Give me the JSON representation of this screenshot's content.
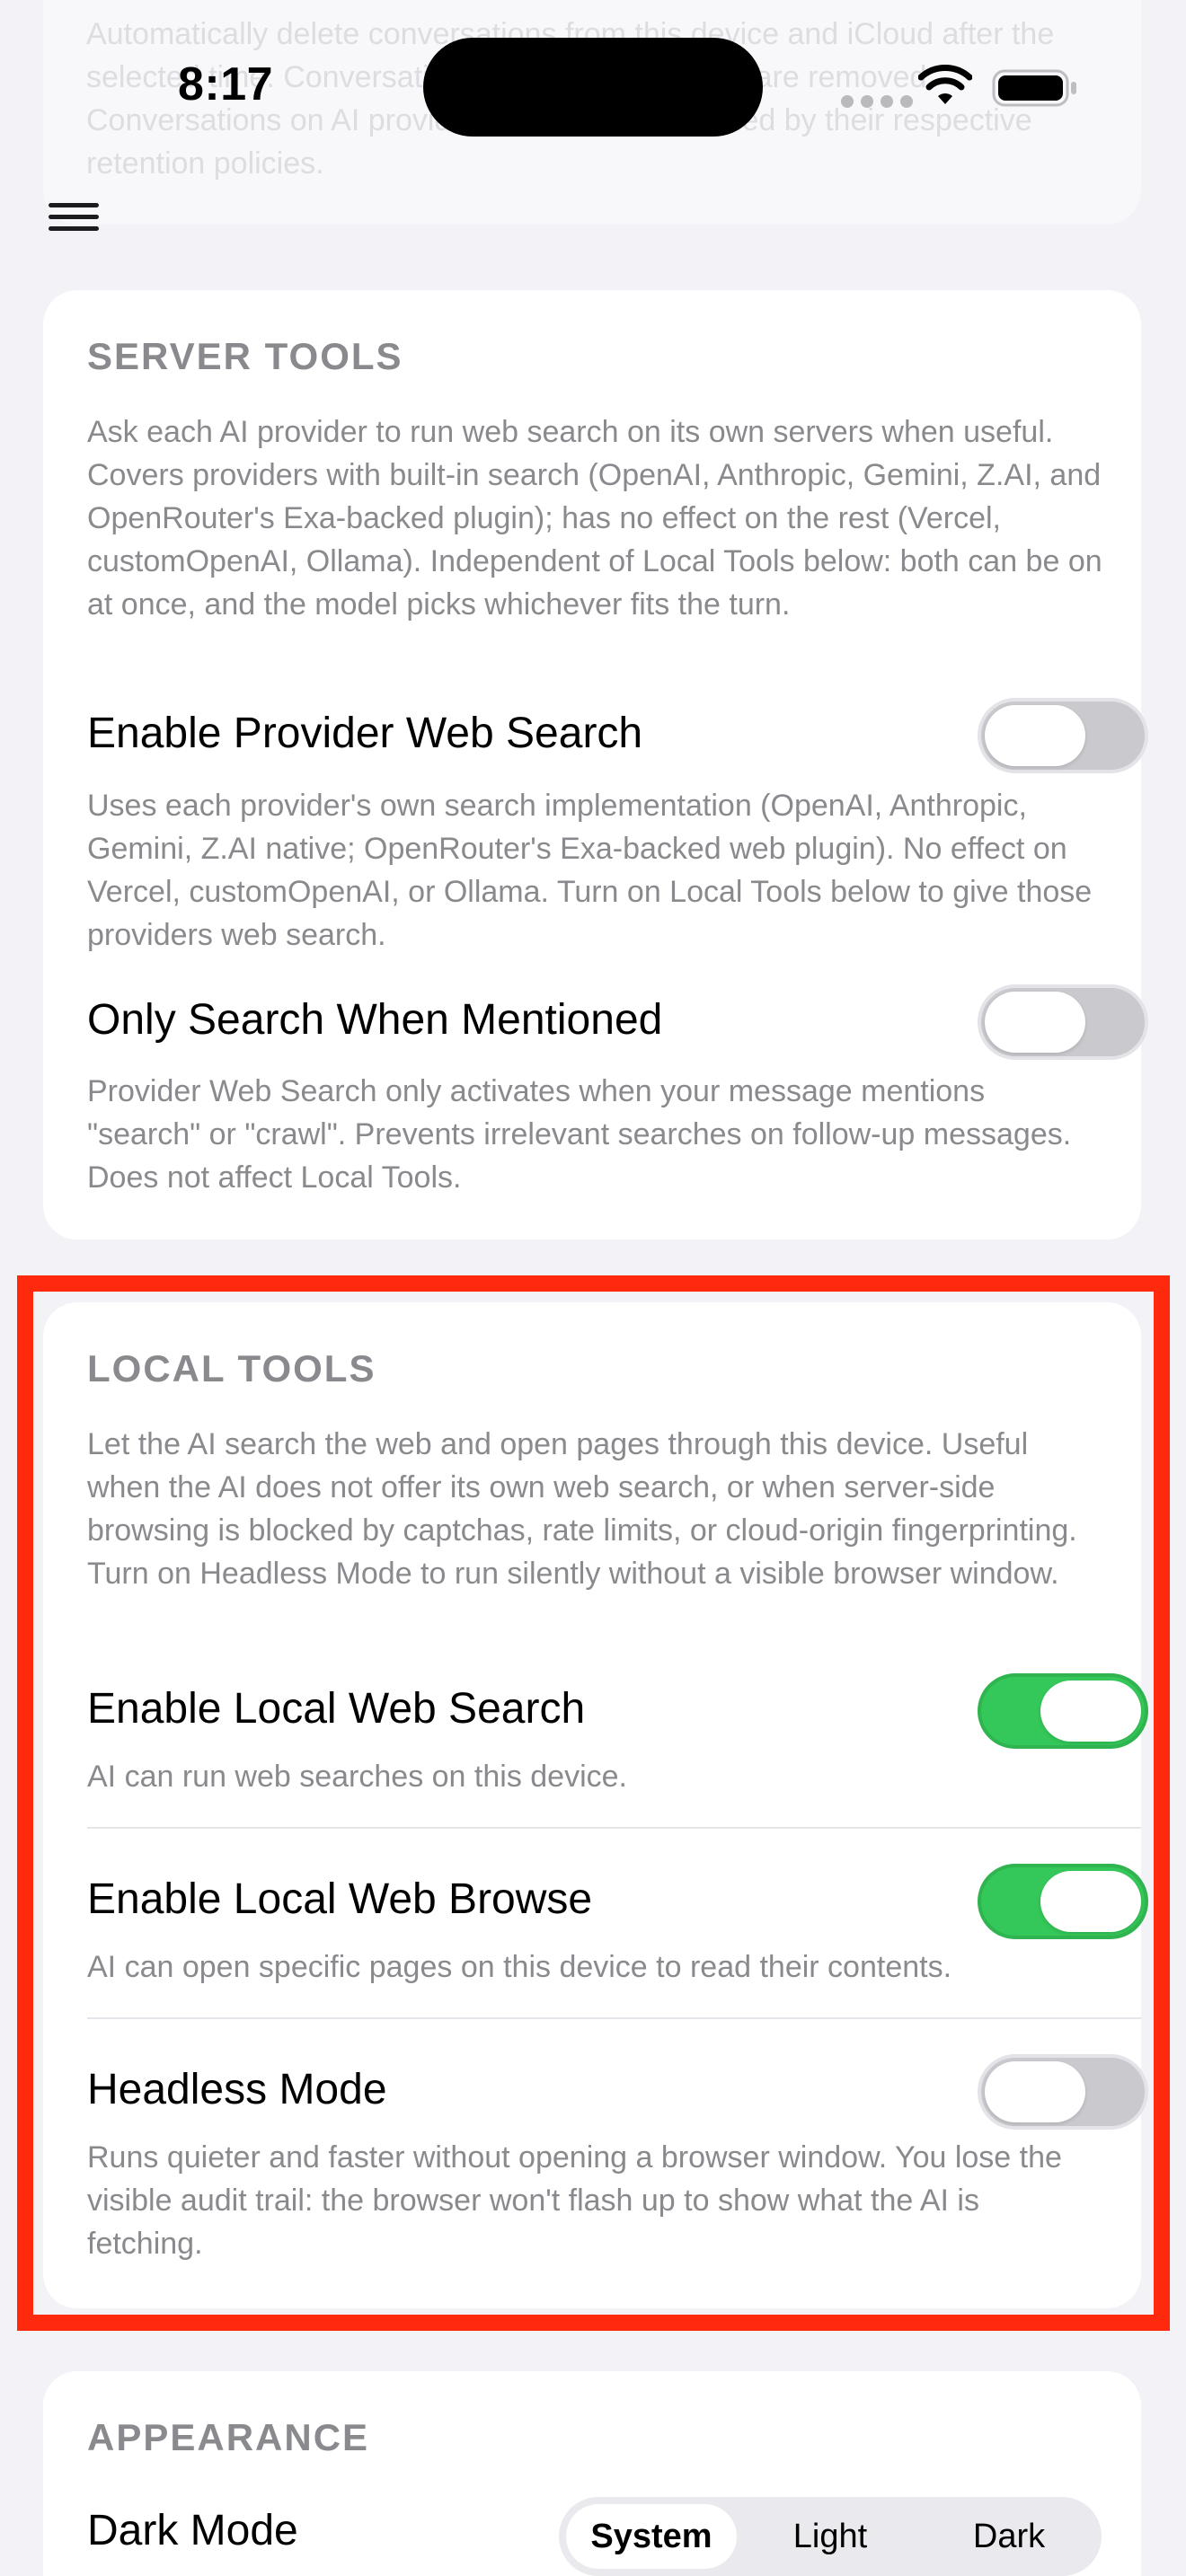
{
  "status_bar": {
    "time": "8:17",
    "wifi_icon": "wifi-icon",
    "battery_icon": "battery-icon"
  },
  "background_text": "Automatically delete conversations from this device and iCloud after the selected time. Conversations and captured items are removed. Conversations on AI provider servers are governed by their respective retention policies.",
  "menu_icon": "hamburger-menu-icon",
  "server_tools": {
    "header": "SERVER TOOLS",
    "description": "Ask each AI provider to run web search on its own servers when useful. Covers providers with built-in search (OpenAI, Anthropic, Gemini, Z.AI, and OpenRouter's Exa-backed plugin); has no effect on the rest (Vercel, customOpenAI, Ollama). Independent of Local Tools below: both can be on at once, and the model picks whichever fits the turn.",
    "provider_search": {
      "title": "Enable Provider Web Search",
      "description": "Uses each provider's own search implementation (OpenAI, Anthropic, Gemini, Z.AI native; OpenRouter's Exa-backed web plugin). No effect on Vercel, customOpenAI, or Ollama. Turn on Local Tools below to give those providers web search.",
      "enabled": false
    },
    "only_mentioned": {
      "title": "Only Search When Mentioned",
      "description": "Provider Web Search only activates when your message mentions \"search\" or \"crawl\". Prevents irrelevant searches on follow-up messages. Does not affect Local Tools.",
      "enabled": false
    }
  },
  "local_tools": {
    "header": "LOCAL TOOLS",
    "description": "Let the AI search the web and open pages through this device. Useful when the AI does not offer its own web search, or when server-side browsing is blocked by captchas, rate limits, or cloud-origin fingerprinting. Turn on Headless Mode to run silently without a visible browser window.",
    "local_search": {
      "title": "Enable Local Web Search",
      "description": "AI can run web searches on this device.",
      "enabled": true
    },
    "local_browse": {
      "title": "Enable Local Web Browse",
      "description": "AI can open specific pages on this device to read their contents.",
      "enabled": true
    },
    "headless": {
      "title": "Headless Mode",
      "description": "Runs quieter and faster without opening a browser window. You lose the visible audit trail: the browser won't flash up to show what the AI is fetching.",
      "enabled": false
    }
  },
  "appearance": {
    "header": "APPEARANCE",
    "dark_mode": {
      "title": "Dark Mode",
      "options": [
        "System",
        "Light",
        "Dark"
      ],
      "selected": "System"
    }
  },
  "colors": {
    "toggle_on": "#34c759",
    "toggle_off": "#c9c9ce",
    "highlight": "#ff2a0d",
    "secondary_text": "#8a8a8e",
    "background": "#f2f2f7"
  }
}
